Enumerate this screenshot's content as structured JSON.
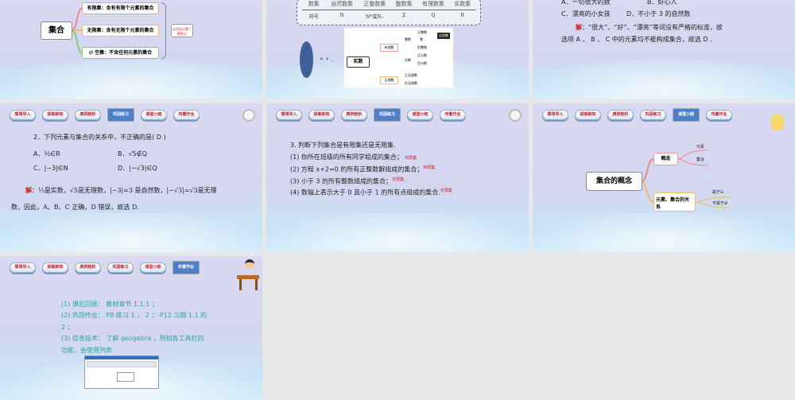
{
  "nav": [
    "情境导入",
    "探索新知",
    "典例剖析",
    "巩固练习",
    "课堂小结",
    "布置作业"
  ],
  "slide1": {
    "root": "集合",
    "finite": "有限集：含有有限个元素的集合",
    "infinite": "无限集：含有无限个元素的集合",
    "empty_symbol": "∅",
    "empty": "空集：不含任何元素的集合",
    "note": "从包含元素个数划分"
  },
  "slide2": {
    "table": {
      "header": [
        "数集",
        "自然数集",
        "正整数集",
        "整数集",
        "有理数集",
        "实数集"
      ],
      "row": [
        "符号",
        "N",
        "N*或N₊",
        "Z",
        "Q",
        "R"
      ]
    },
    "tree": {
      "root": "实数",
      "rational": "有理数",
      "irrational": "无理数",
      "integer": "整数",
      "fraction": "分数",
      "pos_int": "正整数",
      "zero": "零",
      "neg_int": "负整数",
      "natural": "自然数",
      "pos_frac": "正分数",
      "neg_frac": "负分数",
      "pos_irr": "正无理数",
      "neg_irr": "负无理数"
    },
    "dots": "• • ."
  },
  "slide3": {
    "optA": "A．一切很大的数",
    "optB": "B．好心人",
    "optC": "C．漂亮的小女孩",
    "optD": "D．不小于 3 的自然数",
    "sol_label": "解",
    "sol1": "：“很大”、“好”、“漂亮”等词没有严格的标准，故",
    "sol2": "选项 A 、 B 、 C 中的元素均不能构成集合，故选 D ."
  },
  "slide4": {
    "q": "2．下列元素与集合的关系中，不正确的是( D )",
    "A": "A．½∈R",
    "B": "B．√5∉Q",
    "C": "C．|−3|∈N",
    "D": "D．|−√3|∈Q",
    "sol_label": "解：",
    "sol1": "½是实数，√5是无理数，|−3|=3 是自然数，|−√3|=√3是无理",
    "sol2": "数，因此，A、B、C 正确，D 错误，故选 D."
  },
  "slide5": {
    "q": "3. 判断下列集合是有限集还是无限集.",
    "items": [
      "(1) 你所在班级的所有同学组成的集合；",
      "(2) 方程  x+2=0 的所有正整数解组成的集合；",
      "(3) 小于 3 的所有整数组成的集合；",
      "(4) 数轴上表示大于 0 且小于 1 的所有点组成的集合."
    ],
    "answers": [
      "有限集",
      "有限集",
      "无限集",
      "无限集"
    ]
  },
  "slide6": {
    "root": "集合的概念",
    "b1": "概念",
    "b1a": "元素",
    "b1b": "集合",
    "b2": "元素、集合的关系",
    "b2a": "属于∈",
    "b2b": "不属于∉"
  },
  "slide7": {
    "items": [
      "(1) 课后回顾： 教材章节 1.1.1 ；",
      "(2) 巩固作业： P8 练习 1 ， 2 ； P12 习题 1.1 的",
      "2 ；",
      "(3) 信息技术： 了解 geogebra ，熟知各工具栏的",
      "功能，会使用列表."
    ]
  }
}
